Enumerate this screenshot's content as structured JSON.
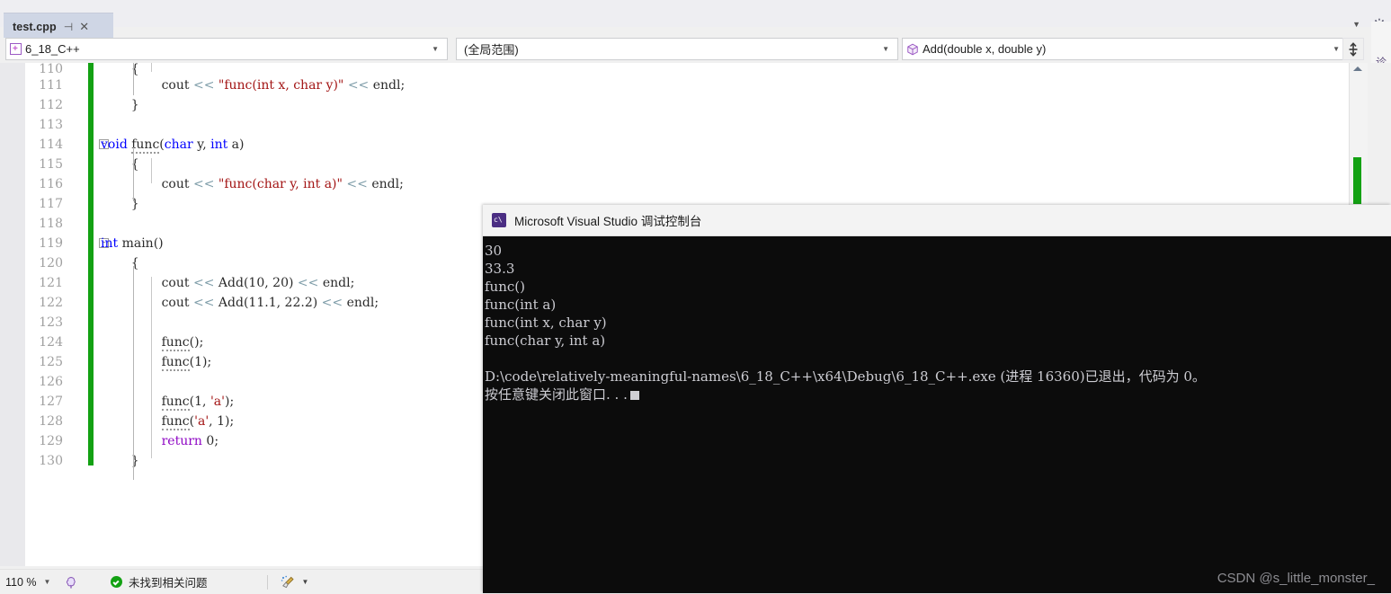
{
  "window": {
    "tab": {
      "title": "test.cpp",
      "pin_icon": "pin-icon",
      "close_icon": "close-icon"
    },
    "tabstrip_right": {
      "chevron": "chevron-down-icon",
      "gear": "gear-icon"
    },
    "vertical_tab_label": "诊断工具"
  },
  "navbar": {
    "project": {
      "value": "6_18_C++",
      "icon": "project-icon"
    },
    "scope": {
      "value": "(全局范围)"
    },
    "member": {
      "value": "Add(double x, double y)",
      "icon": "cube-icon"
    },
    "split_icon": "split-editor-icon",
    "dropdown_icon": "chevron-down-icon"
  },
  "editor": {
    "first_partial_line": "110",
    "lines": [
      {
        "num": "111",
        "indent": 8,
        "text": "cout << \"func(int x, char y)\" << endl;"
      },
      {
        "num": "112",
        "indent": 4,
        "text": "}"
      },
      {
        "num": "113",
        "indent": 0,
        "text": ""
      },
      {
        "num": "114",
        "indent": 0,
        "text": "void func(char y, int a)"
      },
      {
        "num": "115",
        "indent": 4,
        "text": "{"
      },
      {
        "num": "116",
        "indent": 8,
        "text": "cout << \"func(char y, int a)\" << endl;"
      },
      {
        "num": "117",
        "indent": 4,
        "text": "}"
      },
      {
        "num": "118",
        "indent": 0,
        "text": ""
      },
      {
        "num": "119",
        "indent": 0,
        "text": "int main()"
      },
      {
        "num": "120",
        "indent": 4,
        "text": "{"
      },
      {
        "num": "121",
        "indent": 8,
        "text": "cout << Add(10, 20) << endl;"
      },
      {
        "num": "122",
        "indent": 8,
        "text": "cout << Add(11.1, 22.2) << endl;"
      },
      {
        "num": "123",
        "indent": 0,
        "text": ""
      },
      {
        "num": "124",
        "indent": 8,
        "text": "func();"
      },
      {
        "num": "125",
        "indent": 8,
        "text": "func(1);"
      },
      {
        "num": "126",
        "indent": 0,
        "text": ""
      },
      {
        "num": "127",
        "indent": 8,
        "text": "func(1, 'a');"
      },
      {
        "num": "128",
        "indent": 8,
        "text": "func('a', 1);"
      },
      {
        "num": "129",
        "indent": 8,
        "text": "return 0;"
      },
      {
        "num": "130",
        "indent": 4,
        "text": "}"
      }
    ]
  },
  "console": {
    "title": "Microsoft Visual Studio 调试控制台",
    "icon": "cmd-prompt-icon",
    "output": [
      "30",
      "33.3",
      "func()",
      "func(int a)",
      "func(int x, char y)",
      "func(char y, int a)",
      "",
      "D:\\code\\relatively-meaningful-names\\6_18_C++\\x64\\Debug\\6_18_C++.exe (进程 16360)已退出，代码为 0。",
      "按任意键关闭此窗口. . ."
    ]
  },
  "statusbar": {
    "zoom": "110 %",
    "zoom_dropdown": "chevron-down-icon",
    "brain_icon": "intellicode-icon",
    "status_text": "未找到相关问题",
    "status_icon": "check-circle-icon",
    "broom_icon": "code-cleanup-icon",
    "broom_dropdown": "chevron-down-icon"
  },
  "watermark": "CSDN @s_little_monster_",
  "colors": {
    "keyword": "#0000ff",
    "string": "#a31515",
    "operator": "#7d9ca8",
    "plain": "#2b2b2b",
    "return_keyword": "#8f08c4",
    "changebar_green": "#13a113",
    "console_bg": "#0c0c0c",
    "console_fg": "#ccccd2",
    "tab_bg": "#cfd6e5"
  }
}
